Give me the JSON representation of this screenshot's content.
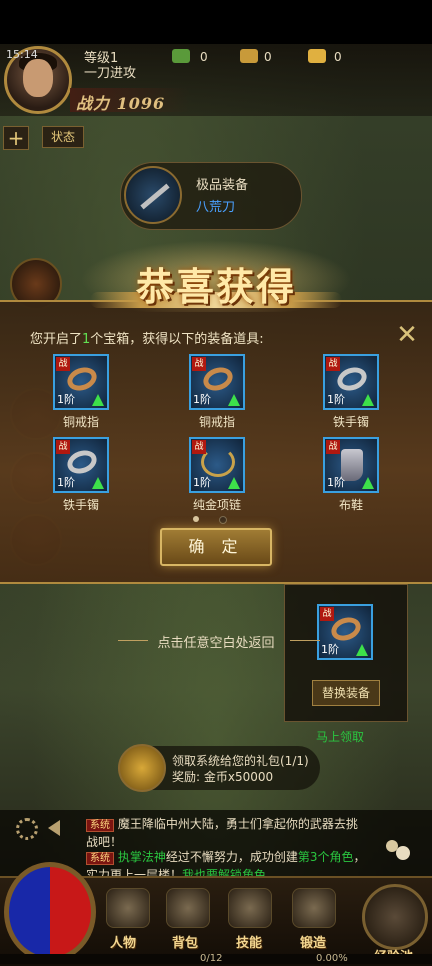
{
  "status_bar": {
    "time": "15:14"
  },
  "player": {
    "level_label": "等级1",
    "title": "一刀进攻",
    "combat_power": "战力 1096"
  },
  "resources": [
    {
      "name": "jade-icon",
      "value": "0",
      "color": "#5a9a3a"
    },
    {
      "name": "gold-ingot-icon",
      "value": "0",
      "color": "#c89a3a"
    },
    {
      "name": "yuanbao-icon",
      "value": "0",
      "color": "#e0b040"
    }
  ],
  "top_buttons": {
    "plus": "+",
    "status": "状态"
  },
  "equip_banner": {
    "label": "极品装备",
    "item_name": "八荒刀"
  },
  "modal": {
    "title": "恭喜获得",
    "message_prefix": "您开启了",
    "message_count": "1",
    "message_suffix": "个宝箱，获得以下的装备道具:",
    "close_icon": "close-icon",
    "items": [
      {
        "name": "铜戒指",
        "tier": "1阶",
        "tag": "战",
        "icon": "ring-icon"
      },
      {
        "name": "铜戒指",
        "tier": "1阶",
        "tag": "战",
        "icon": "ring-icon"
      },
      {
        "name": "铁手镯",
        "tier": "1阶",
        "tag": "战",
        "icon": "bracelet-icon"
      },
      {
        "name": "铁手镯",
        "tier": "1阶",
        "tag": "战",
        "icon": "bracelet-icon"
      },
      {
        "name": "纯金项链",
        "tier": "1阶",
        "tag": "战",
        "icon": "necklace-icon"
      },
      {
        "name": "布鞋",
        "tier": "1阶",
        "tag": "战",
        "icon": "boots-icon"
      }
    ],
    "confirm_label": "确 定"
  },
  "hint": "点击任意空白处返回",
  "compare": {
    "tier": "1阶",
    "tag": "战",
    "replace_label": "替换装备",
    "green_text": "马上领取"
  },
  "gift": {
    "line1": "领取系统给您的礼包(1/1)",
    "line2": "奖励: 金币x50000"
  },
  "chat": {
    "badge": "系统",
    "line1": "魔王降临中州大陆，勇士们拿起你的武器去挑战吧！",
    "line2_name": "执掌法神",
    "line2_mid": "经过不懈努力，成功创建",
    "line2_count": "第3个角色",
    "line2_end": "，实力更上一层楼！",
    "line2_link": "我也要解锁角色"
  },
  "menu": [
    {
      "label": "人物",
      "icon": "helmet-icon"
    },
    {
      "label": "背包",
      "icon": "bag-icon"
    },
    {
      "label": "技能",
      "icon": "skill-book-icon"
    },
    {
      "label": "锻造",
      "icon": "anvil-icon"
    },
    {
      "label": "经验池",
      "icon": "dragon-icon"
    }
  ],
  "exp": {
    "bag_count": "0/12",
    "exp_percent": "0.00%"
  }
}
